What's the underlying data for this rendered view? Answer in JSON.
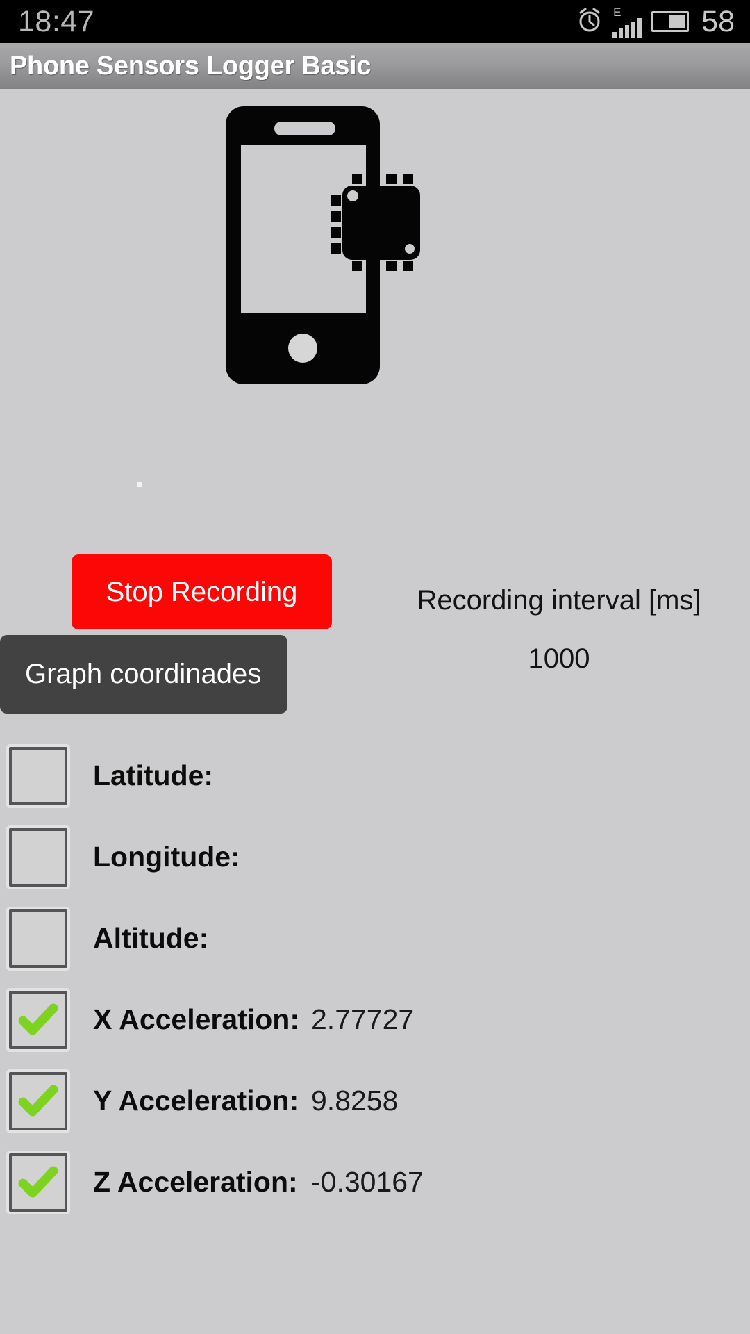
{
  "status_bar": {
    "time": "18:47",
    "battery_percent": "58",
    "network_type": "E",
    "icons": [
      "alarm-clock-icon",
      "signal-bars-icon",
      "battery-icon"
    ]
  },
  "app": {
    "title": "Phone Sensors Logger Basic"
  },
  "hero": {
    "icon": "phone-with-sensor-chip-icon"
  },
  "controls": {
    "record_button_label": "Stop Recording",
    "record_button_color": "#fc0606",
    "graph_button_label": "Graph coordinades",
    "graph_button_color": "#424242",
    "interval_label": "Recording interval [ms]",
    "interval_value": "1000"
  },
  "sensors": [
    {
      "label": "Latitude:",
      "value": "",
      "checked": false
    },
    {
      "label": "Longitude:",
      "value": "",
      "checked": false
    },
    {
      "label": "Altitude:",
      "value": "",
      "checked": false
    },
    {
      "label": "X Acceleration:",
      "value": "2.77727",
      "checked": true
    },
    {
      "label": "Y Acceleration:",
      "value": "9.8258",
      "checked": true
    },
    {
      "label": "Z Acceleration:",
      "value": "-0.30167",
      "checked": true
    }
  ],
  "colors": {
    "background": "#ccccce",
    "titlebar_top": "#a9a9ab",
    "titlebar_bottom": "#828284",
    "statusbar": "#000000",
    "checkmark_green": "#7ed321",
    "checkbox_border": "#555558"
  }
}
